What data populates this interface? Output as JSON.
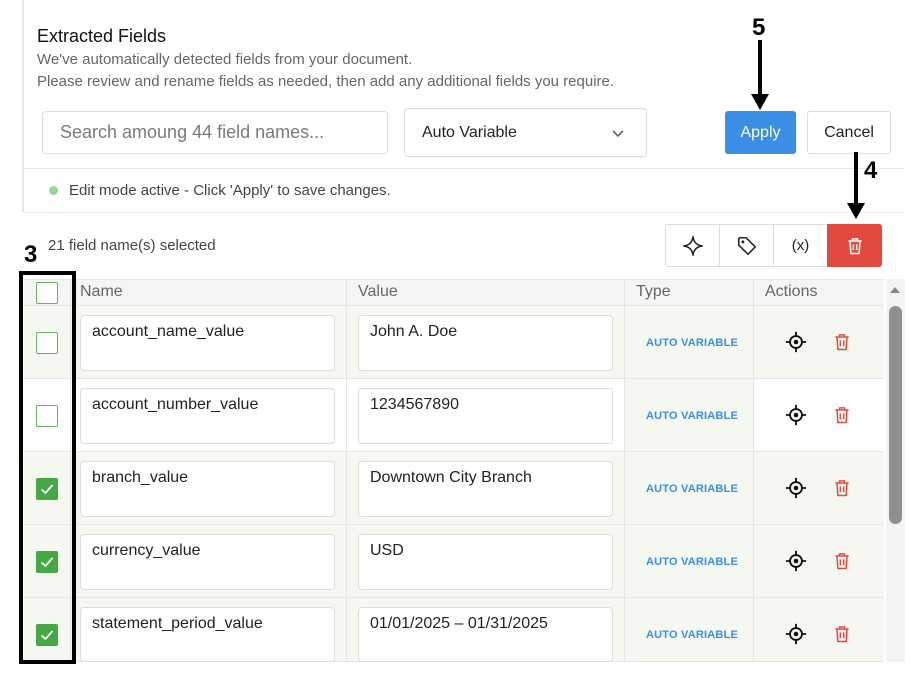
{
  "header": {
    "title": "Extracted Fields",
    "subtitle_line1": "We've automatically detected fields from your document.",
    "subtitle_line2": "Please review and rename fields as needed, then add any additional fields you require."
  },
  "search": {
    "placeholder": "Search amoung 44 field names..."
  },
  "type_select": {
    "value": "Auto Variable"
  },
  "buttons": {
    "apply": "Apply",
    "cancel": "Cancel"
  },
  "status": {
    "text": "Edit mode active - Click 'Apply' to save changes.",
    "dot_color": "#9bd39b"
  },
  "selection": {
    "count_text": "21 field name(s) selected"
  },
  "toolbar": {
    "icons": [
      "sparkle-icon",
      "tag-icon",
      "variable-icon",
      "trash-icon"
    ],
    "variable_glyph": "(x)"
  },
  "table": {
    "columns": [
      "Name",
      "Value",
      "Type",
      "Actions"
    ],
    "rows": [
      {
        "checked": false,
        "name": "account_name_value",
        "value": "John A. Doe",
        "type": "AUTO VARIABLE"
      },
      {
        "checked": false,
        "name": "account_number_value",
        "value": "1234567890",
        "type": "AUTO VARIABLE"
      },
      {
        "checked": true,
        "name": "branch_value",
        "value": "Downtown City Branch",
        "type": "AUTO VARIABLE"
      },
      {
        "checked": true,
        "name": "currency_value",
        "value": "USD",
        "type": "AUTO VARIABLE"
      },
      {
        "checked": true,
        "name": "statement_period_value",
        "value": "01/01/2025 – 01/31/2025",
        "type": "AUTO VARIABLE"
      }
    ]
  },
  "annotations": {
    "label3": "3",
    "label4": "4",
    "label5": "5"
  },
  "colors": {
    "primary": "#3a8ee6",
    "danger": "#e34a3f",
    "check": "#45a844",
    "type_text": "#3a8ee6"
  }
}
